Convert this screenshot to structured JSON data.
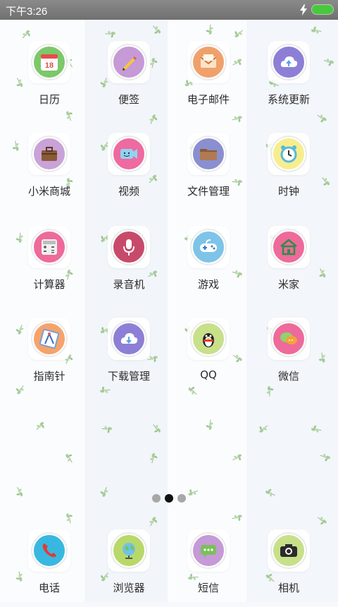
{
  "status_bar": {
    "time": "下午3:26",
    "battery_color": "#48c93b"
  },
  "apps": [
    {
      "label": "日历",
      "icon": "calendar-icon",
      "color": "#7cc86a",
      "badge": "18"
    },
    {
      "label": "便签",
      "icon": "pencil-icon",
      "color": "#c59ad6"
    },
    {
      "label": "电子邮件",
      "icon": "mail-icon",
      "color": "#f0a16b"
    },
    {
      "label": "系统更新",
      "icon": "cloud-upload-icon",
      "color": "#8d7fd6"
    },
    {
      "label": "小米商城",
      "icon": "bag-icon",
      "color": "#c9a2d8"
    },
    {
      "label": "视频",
      "icon": "video-icon",
      "color": "#ee6aa0"
    },
    {
      "label": "文件管理",
      "icon": "folder-icon",
      "color": "#8a8fd0"
    },
    {
      "label": "时钟",
      "icon": "alarm-clock-icon",
      "color": "#f6ee8e"
    },
    {
      "label": "计算器",
      "icon": "calculator-icon",
      "color": "#ee6a9a"
    },
    {
      "label": "录音机",
      "icon": "microphone-icon",
      "color": "#c74a6a"
    },
    {
      "label": "游戏",
      "icon": "gamepad-icon",
      "color": "#7ec4e8"
    },
    {
      "label": "米家",
      "icon": "home-icon",
      "color": "#ee6a9a"
    },
    {
      "label": "指南针",
      "icon": "compass-icon",
      "color": "#f5a36b"
    },
    {
      "label": "下载管理",
      "icon": "cloud-download-icon",
      "color": "#8d7fd6"
    },
    {
      "label": "QQ",
      "icon": "penguin-icon",
      "color": "#c8e08a"
    },
    {
      "label": "微信",
      "icon": "chat-icon",
      "color": "#ee6a9a"
    }
  ],
  "page_indicator": {
    "pages": 3,
    "active": 1
  },
  "dock": [
    {
      "label": "电话",
      "icon": "phone-icon",
      "color": "#38b8e0"
    },
    {
      "label": "浏览器",
      "icon": "globe-icon",
      "color": "#b8d86a"
    },
    {
      "label": "短信",
      "icon": "message-icon",
      "color": "#c59ad6"
    },
    {
      "label": "相机",
      "icon": "camera-icon",
      "color": "#c8e08a"
    }
  ]
}
